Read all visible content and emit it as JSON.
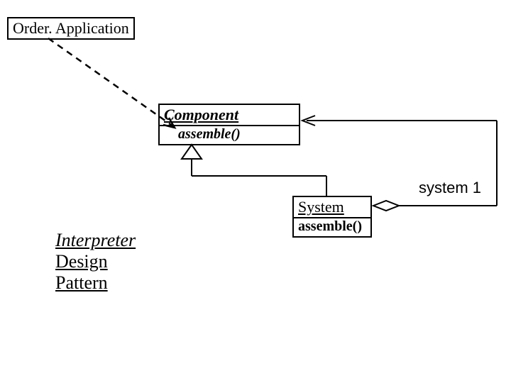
{
  "classes": {
    "orderApp": {
      "name": "Order. Application"
    },
    "component": {
      "name": "Component",
      "method": "assemble()"
    },
    "system": {
      "name": "System",
      "method": "assemble()"
    }
  },
  "roles": {
    "system1": "system 1"
  },
  "pattern": {
    "line1": "Interpreter",
    "line2": "Design",
    "line3": "Pattern"
  }
}
